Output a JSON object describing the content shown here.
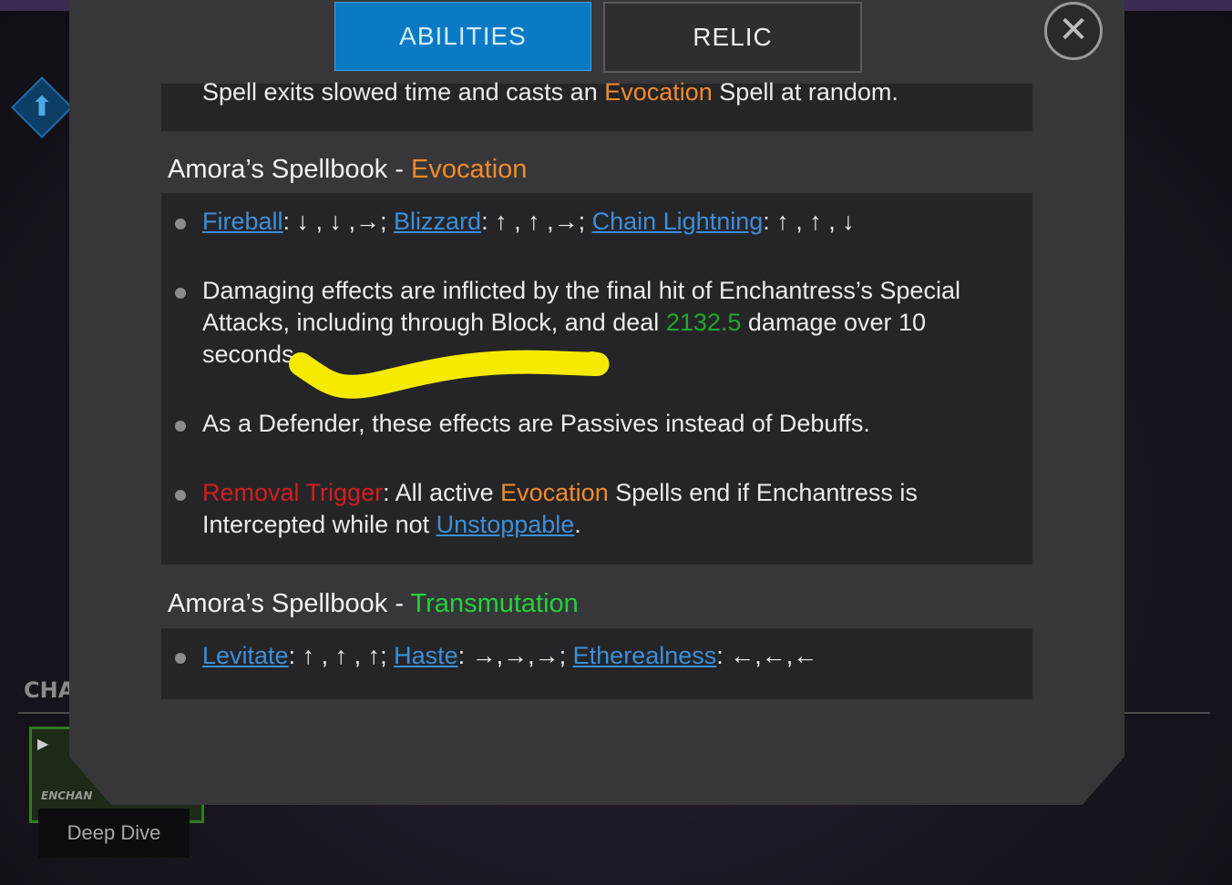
{
  "background": {
    "section_label": "CHA",
    "card_name": "ENCHAN",
    "deep_dive_label": "Deep Dive"
  },
  "tabs": [
    {
      "label": "ABILITIES",
      "active": true
    },
    {
      "label": "RELIC",
      "active": false
    }
  ],
  "close_icon": "close-icon",
  "intro": {
    "before": "Spell exits slowed time and casts an ",
    "highlight": "Evocation",
    "after": " Spell at random."
  },
  "evocation_section": {
    "title_prefix": "Amora’s Spellbook - ",
    "title_accent": "Evocation",
    "b1": {
      "spell1": "Fireball",
      "seq1": ": ↓ , ↓ ,→; ",
      "spell2": "Blizzard",
      "seq2": ": ↑ , ↑ ,→; ",
      "spell3": "Chain Lightning",
      "seq3": ": ↑ , ↑ , ↓"
    },
    "b2": {
      "line1": "Damaging effects are inflicted by the final hit of Enchantress’s Special",
      "line2_before": "Attacks, including through Block, and deal ",
      "line2_value": "2132.5",
      "line2_after": " damage over 10",
      "line3": "seconds."
    },
    "b3": "As a Defender, these effects are Passives instead of Debuffs.",
    "b4": {
      "trigger": "Removal Trigger",
      "part1": ": All active ",
      "accent": "Evocation",
      "part2": " Spells end if Enchantress is",
      "line2_before": "Intercepted while not ",
      "link": "Unstoppable",
      "line2_after": "."
    }
  },
  "transmutation_section": {
    "title_prefix": "Amora’s Spellbook - ",
    "title_accent": "Transmutation",
    "b1": {
      "spell1": "Levitate",
      "seq1": ": ↑ , ↑ , ↑; ",
      "spell2": "Haste",
      "seq2": ": →,→,→; ",
      "spell3": "Etherealness",
      "seq3": ": ←,←,←"
    }
  },
  "colors": {
    "tab_active": "#0a7ac4",
    "link": "#3b8fdc",
    "evocation": "#f28b2c",
    "damage_value": "#1ea82d",
    "transmutation": "#1fd43a",
    "removal_trigger": "#d11f1f",
    "annotation_highlight": "#f5ea00"
  }
}
